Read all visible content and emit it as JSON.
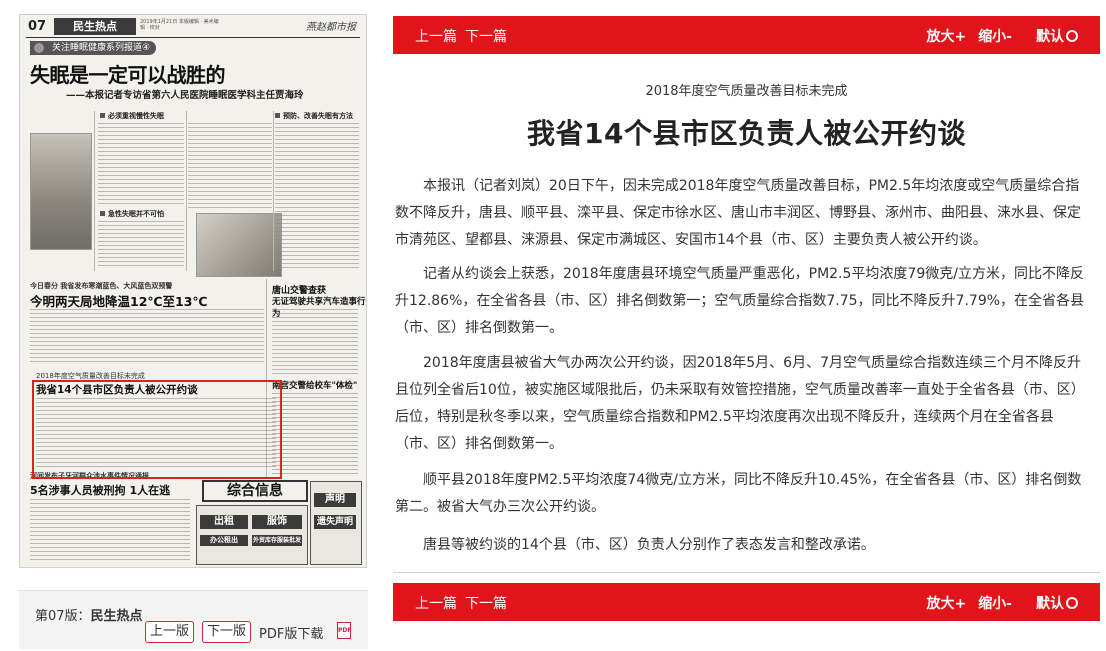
{
  "newspaper": {
    "page_number": "07",
    "section": "民生热点",
    "masthead": "燕赵都市报",
    "date_line": "2019年1月21日 本版编辑 · 美术编辑 · 校对",
    "series_heading": "关注睡眠健康系列报道④",
    "main_title": "失眠是一定可以战胜的",
    "main_subtitle": "——本报记者专访省第六人民医院睡眠医学科主任贾海玲",
    "subheads": [
      "必须重视慢性失眠",
      "预防、改善失眠有方法",
      "急性失眠并不可怕"
    ],
    "weather_kicker": "今日春分 我省发布寒潮蓝色、大风蓝色双预警",
    "weather_title": "今明两天局地降温12℃至13℃",
    "right_brief_title": "唐山交警查获",
    "right_brief_subtitle": "无证驾驶共享汽车造事行为",
    "story_kicker": "2018年度空气质量改善目标未完成",
    "story_title": "我省14个县市区负责人被公开约谈",
    "school_title": "南宫交警给校车\"体检\"",
    "lower_kicker": "河间发布子牙河群众涉水事件情况通报",
    "lower_title": "5名涉事人员被刑拘 1人在逃",
    "ad_title": "综合信息",
    "ad_bars": [
      "出租",
      "服饰",
      "声明",
      "遗失声明",
      "办公租出",
      "外贸库存服装批发"
    ]
  },
  "caption": {
    "edition_prefix": "第07版：",
    "edition_name": "民生热点",
    "prev_page": "上一版",
    "next_page": "下一版",
    "pdf_label": "PDF版下载",
    "pdf_icon_text": "PDF"
  },
  "toolbar": {
    "prev_article": "上一篇",
    "next_article": "下一篇",
    "zoom_in": "放大+",
    "zoom_out": "缩小-",
    "reset": "默认"
  },
  "article": {
    "kicker": "2018年度空气质量改善目标未完成",
    "headline": "我省14个县市区负责人被公开约谈",
    "paragraphs": [
      "本报讯（记者刘岚）20日下午，因未完成2018年度空气质量改善目标，PM2.5年均浓度或空气质量综合指数不降反升，唐县、顺平县、滦平县、保定市徐水区、唐山市丰润区、博野县、涿州市、曲阳县、涞水县、保定市清苑区、望都县、涞源县、保定市满城区、安国市14个县（市、区）主要负责人被公开约谈。",
      "记者从约谈会上获悉，2018年度唐县环境空气质量严重恶化，PM2.5平均浓度79微克/立方米，同比不降反升12.86%，在全省各县（市、区）排名倒数第一；空气质量综合指数7.75，同比不降反升7.79%，在全省各县（市、区）排名倒数第一。",
      "2018年度唐县被省大气办两次公开约谈，因2018年5月、6月、7月空气质量综合指数连续三个月不降反升且位列全省后10位，被实施区域限批后，仍未采取有效管控措施，空气质量改善率一直处于全省各县（市、区）后位，特别是秋冬季以来，空气质量综合指数和PM2.5平均浓度再次出现不降反升，连续两个月在全省各县（市、区）排名倒数第一。",
      "顺平县2018年度PM2.5平均浓度74微克/立方米，同比不降反升10.45%，在全省各县（市、区）排名倒数第二。被省大气办三次公开约谈。",
      "唐县等被约谈的14个县（市、区）负责人分别作了表态发言和整改承诺。"
    ]
  },
  "colors": {
    "accent_red": "#e0141a",
    "highlight_border": "#e02020"
  }
}
